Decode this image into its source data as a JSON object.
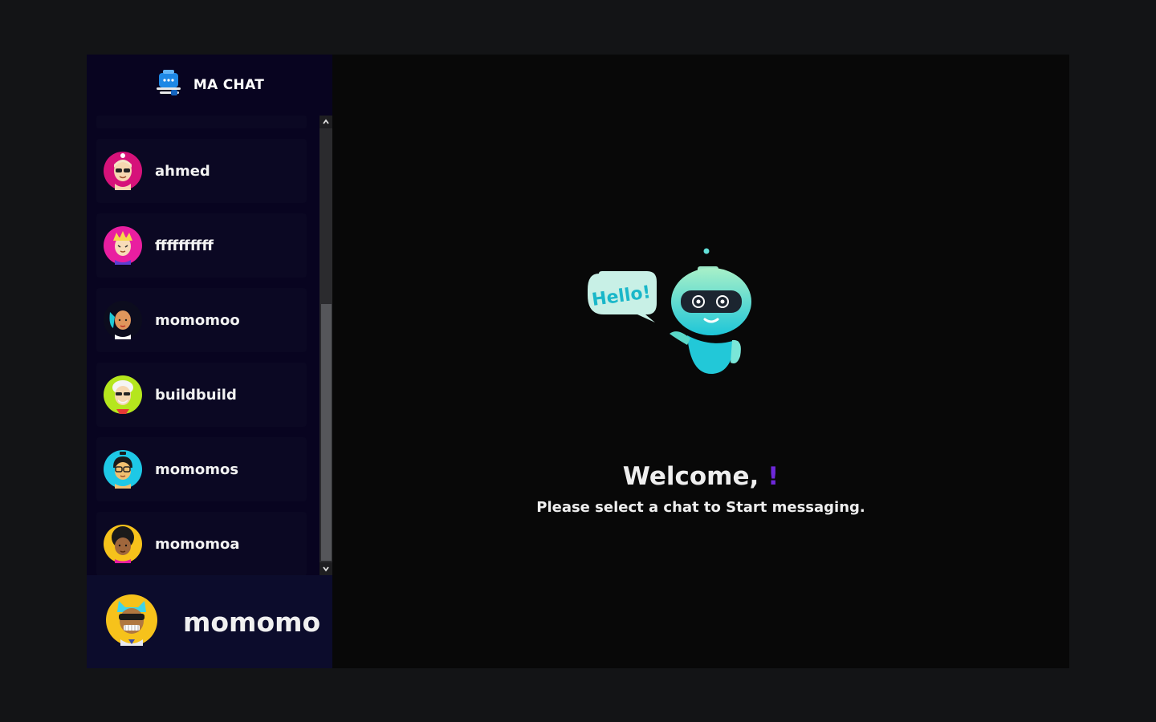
{
  "app": {
    "title": "MA CHAT"
  },
  "sidebar": {
    "contacts": [
      {
        "name": "ahmed",
        "avatar": "avatar-ahmed"
      },
      {
        "name": "ffffffffff",
        "avatar": "avatar-ffffffffff"
      },
      {
        "name": "momomoo",
        "avatar": "avatar-momomoo"
      },
      {
        "name": "buildbuild",
        "avatar": "avatar-buildbuild"
      },
      {
        "name": "momomos",
        "avatar": "avatar-momomos"
      },
      {
        "name": "momomoa",
        "avatar": "avatar-momomoa"
      }
    ]
  },
  "current_user": {
    "name": "momomo",
    "avatar": "avatar-current-user"
  },
  "main": {
    "welcome_text": "Welcome,",
    "welcome_mark": "!",
    "subtitle": "Please select a chat to Start messaging.",
    "illustration_text": "Hello!"
  },
  "colors": {
    "background": "#131416",
    "sidebar": "#080420",
    "contact_card": "#0b0823",
    "current_user_bar": "#0c0c2c",
    "main_panel": "#080808",
    "accent": "#6d28d9"
  },
  "icons": {
    "logo": "chat-robot-logo-icon",
    "scroll_up": "chevron-up-icon",
    "scroll_down": "chevron-down-icon"
  }
}
